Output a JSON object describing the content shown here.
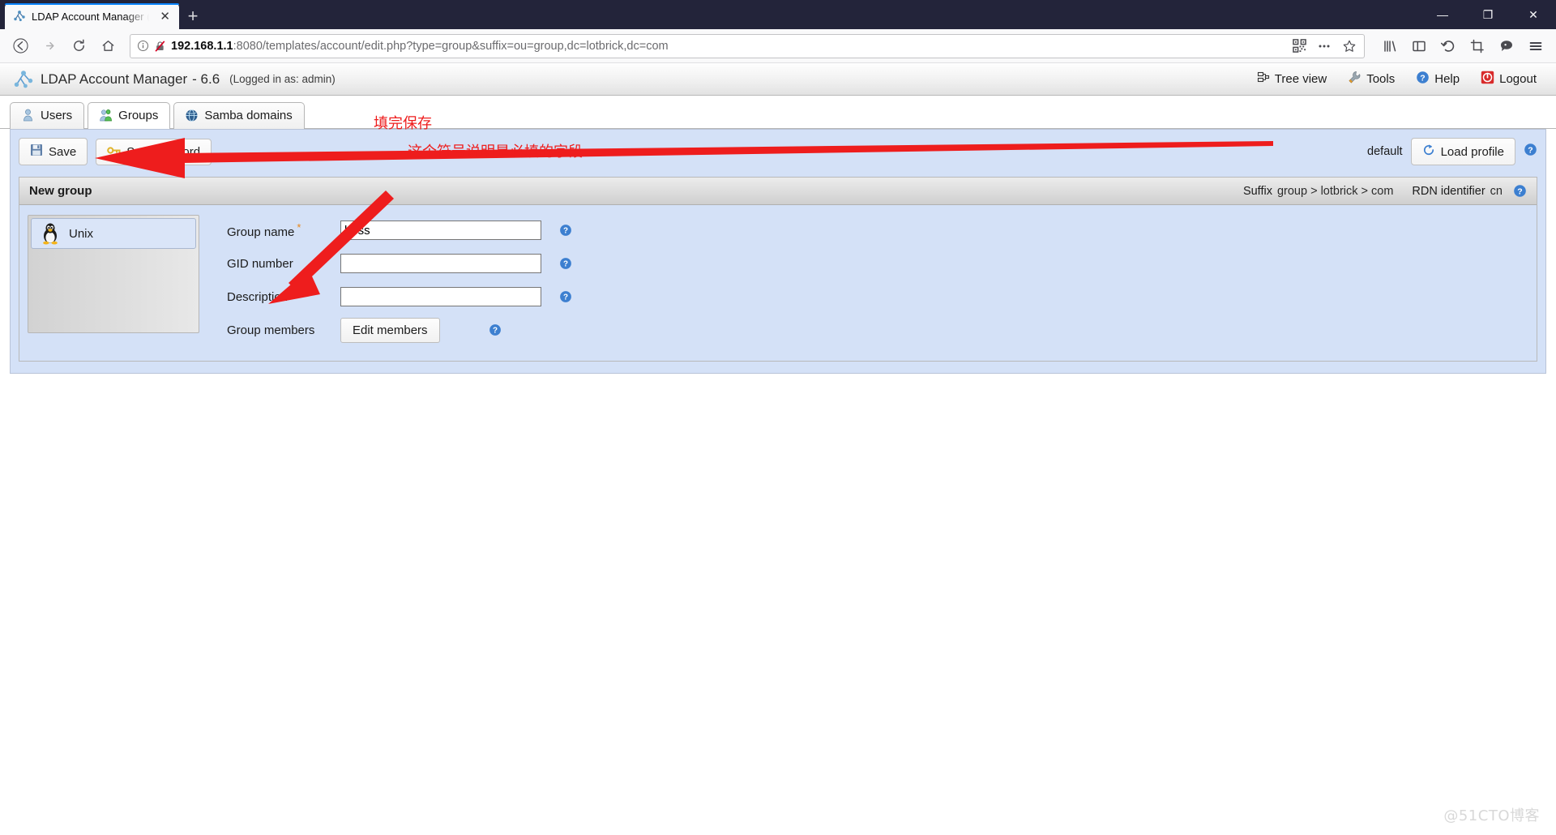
{
  "browser": {
    "tab": {
      "title": "LDAP Account Manager (ope",
      "favicon": "lam-tree-icon",
      "close_label": "✕"
    },
    "newtab_label": "+",
    "window_controls": {
      "minimize": "—",
      "restore": "❐",
      "close": "✕"
    },
    "nav": {
      "back": "back-arrow",
      "forward": "forward-arrow",
      "reload": "reload",
      "home": "home"
    },
    "url": {
      "host": "192.168.1.1",
      "path": ":8080/templates/account/edit.php?type=group&suffix=ou=group,dc=lotbrick,dc=com",
      "full": "192.168.1.1:8080/templates/account/edit.php?type=group&suffix=ou=group,dc=lotbrick,dc=com",
      "identity_icon": "info-circle-icon",
      "insecure_login_icon": "crossed-out-padlock-icon",
      "qr_icon": "qr-code-icon",
      "page_actions_icon": "ellipsis-icon",
      "bookmark_icon": "star-icon"
    },
    "toolbar_icons": [
      "library-icon",
      "sidebar-icon",
      "sync-undo-icon",
      "screenshot-crop-icon",
      "pocket-chat-icon",
      "hamburger-menu-icon"
    ]
  },
  "lam": {
    "header": {
      "logo": "lam-tree-icon",
      "title": "LDAP Account Manager",
      "version": "- 6.6",
      "logged_in": "(Logged in as: admin)",
      "links": [
        {
          "label": "Tree view",
          "icon": "tree-view-icon"
        },
        {
          "label": "Tools",
          "icon": "wrench-icon"
        },
        {
          "label": "Help",
          "icon": "help-circle-icon"
        },
        {
          "label": "Logout",
          "icon": "logout-power-icon"
        }
      ]
    },
    "tabs": [
      {
        "label": "Users",
        "icon": "user-icon",
        "active": false
      },
      {
        "label": "Groups",
        "icon": "group-icon",
        "active": true
      },
      {
        "label": "Samba domains",
        "icon": "globe-icon",
        "active": false
      }
    ],
    "toolbar": {
      "save_label": "Save",
      "save_icon": "floppy-disk-icon",
      "set_password_label": "Set password",
      "set_password_icon": "key-icon",
      "profile_name": "default",
      "load_profile_label": "Load profile",
      "load_profile_icon": "refresh-circle-icon",
      "help_icon": "help-circle-icon"
    },
    "panel": {
      "title": "New group",
      "suffix_label": "Suffix",
      "suffix_value": "group > lotbrick > com",
      "rdn_label": "RDN identifier",
      "rdn_value": "cn",
      "help_icon": "help-circle-icon"
    },
    "modules": [
      {
        "label": "Unix",
        "icon": "tux-penguin-icon",
        "selected": true
      }
    ],
    "form": {
      "required_marker": "*",
      "fields": [
        {
          "name": "group-name",
          "label": "Group name",
          "required": true,
          "type": "text",
          "value": "boss",
          "help_icon": "help-circle-icon"
        },
        {
          "name": "gid-number",
          "label": "GID number",
          "required": false,
          "type": "text",
          "value": "",
          "help_icon": "help-circle-icon"
        },
        {
          "name": "description",
          "label": "Description",
          "required": false,
          "type": "text",
          "value": "",
          "help_icon": "help-circle-icon"
        },
        {
          "name": "group-members",
          "label": "Group members",
          "required": false,
          "type": "button",
          "value": "Edit members",
          "help_icon": "help-circle-icon"
        }
      ]
    }
  },
  "annotations": {
    "note_save": "填完保存",
    "note_required": "这个符号说明是必填的字段",
    "arrow_color": "#ee1d1d"
  },
  "watermark": "@51CTO博客"
}
